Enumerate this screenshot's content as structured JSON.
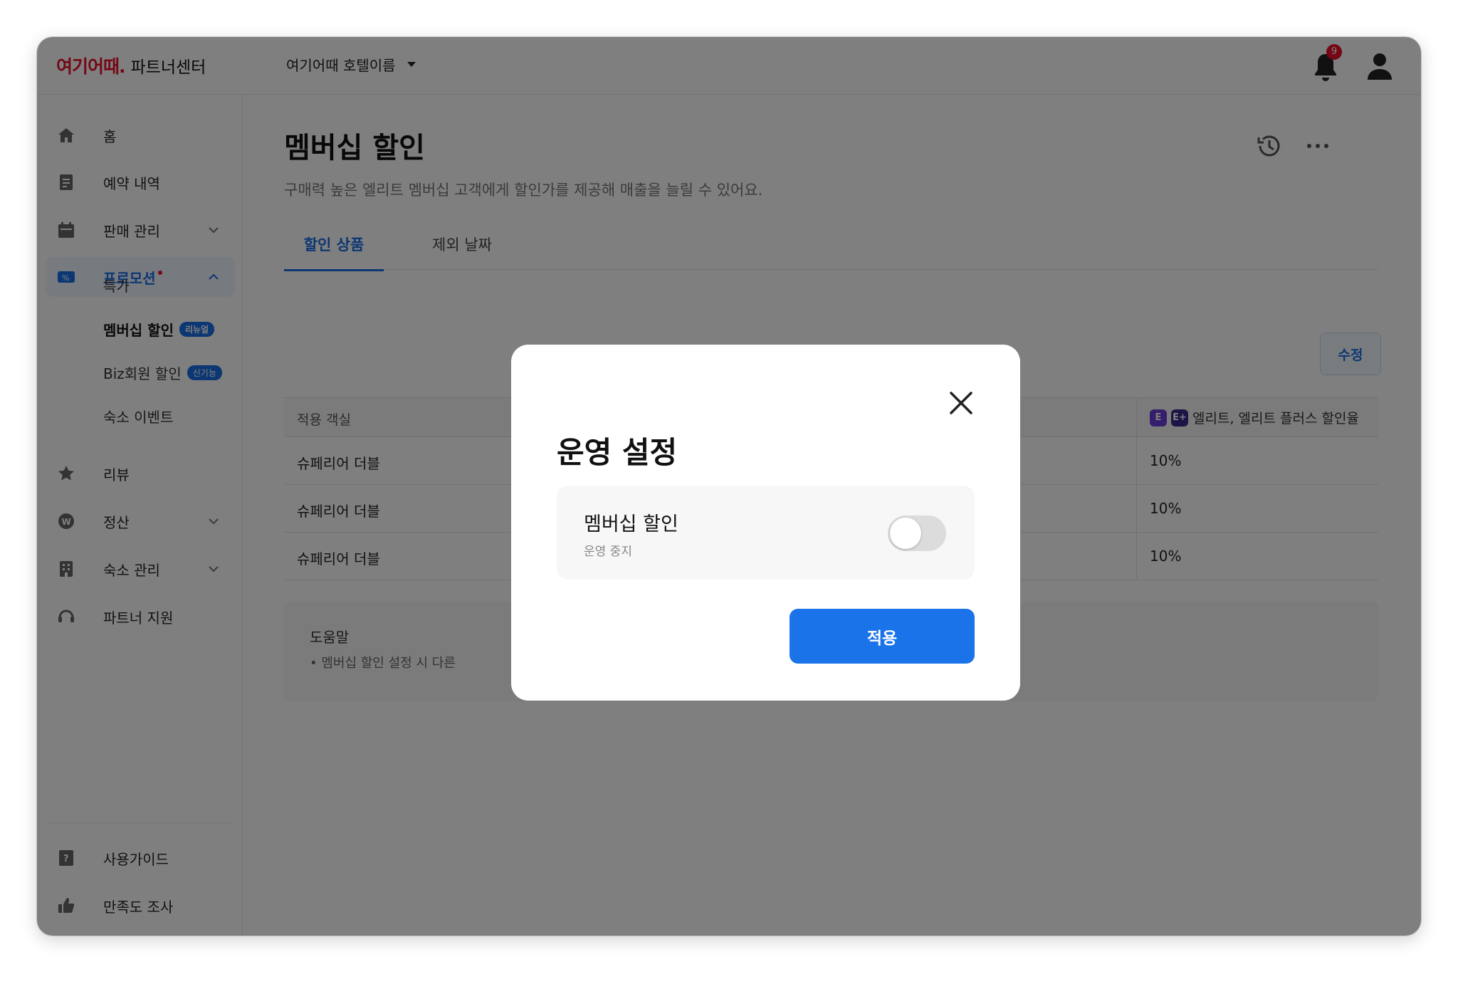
{
  "header": {
    "logo_brand": "여기어때.",
    "logo_sub": "파트너센터",
    "hotel_name": "여기어때 호텔이름",
    "notification_count": "9"
  },
  "sidebar": {
    "items": [
      {
        "label": "홈",
        "icon": "home-icon"
      },
      {
        "label": "예약 내역",
        "icon": "document-icon"
      },
      {
        "label": "판매 관리",
        "icon": "calendar-icon"
      },
      {
        "label": "프로모션",
        "icon": "coupon-icon"
      },
      {
        "label": "리뷰",
        "icon": "star-icon"
      },
      {
        "label": "정산",
        "icon": "won-icon"
      },
      {
        "label": "숙소 관리",
        "icon": "building-icon"
      },
      {
        "label": "파트너 지원",
        "icon": "headset-icon"
      },
      {
        "label": "사용가이드",
        "icon": "guide-icon"
      },
      {
        "label": "만족도 조사",
        "icon": "thumbs-up-icon"
      }
    ],
    "promo_sub": [
      {
        "label": "특가",
        "badge": ""
      },
      {
        "label": "멤버십 할인",
        "badge": "리뉴얼"
      },
      {
        "label": "Biz회원 할인",
        "badge": "신기능"
      },
      {
        "label": "숙소 이벤트",
        "badge": ""
      }
    ]
  },
  "main": {
    "title": "멤버십 할인",
    "description": "구매력 높은 엘리트 멤버십 고객에게 할인가를 제공해 매출을 늘릴 수 있어요.",
    "tabs": [
      "할인 상품",
      "제외 날짜"
    ],
    "edit_label": "수정",
    "table": {
      "col_room": "적용 객실",
      "col_discount": "엘리트, 엘리트 플러스 할인율",
      "grade_e": "E",
      "grade_ep": "E+",
      "rows": [
        {
          "room": "슈페리어 더블",
          "discount": "10%"
        },
        {
          "room": "슈페리어 더블",
          "discount": "10%"
        },
        {
          "room": "슈페리어 더블",
          "discount": "10%"
        }
      ]
    },
    "help": {
      "title": "도움말",
      "text": "• 멤버십 할인 설정 시 다른"
    }
  },
  "modal": {
    "title": "운영 설정",
    "setting_title": "멤버십 할인",
    "setting_status": "운영 중지",
    "toggle_on": false,
    "apply_label": "적용"
  },
  "colors": {
    "brand": "#e8112d",
    "accent": "#1a73e8",
    "grade": "#6a3fd8"
  }
}
